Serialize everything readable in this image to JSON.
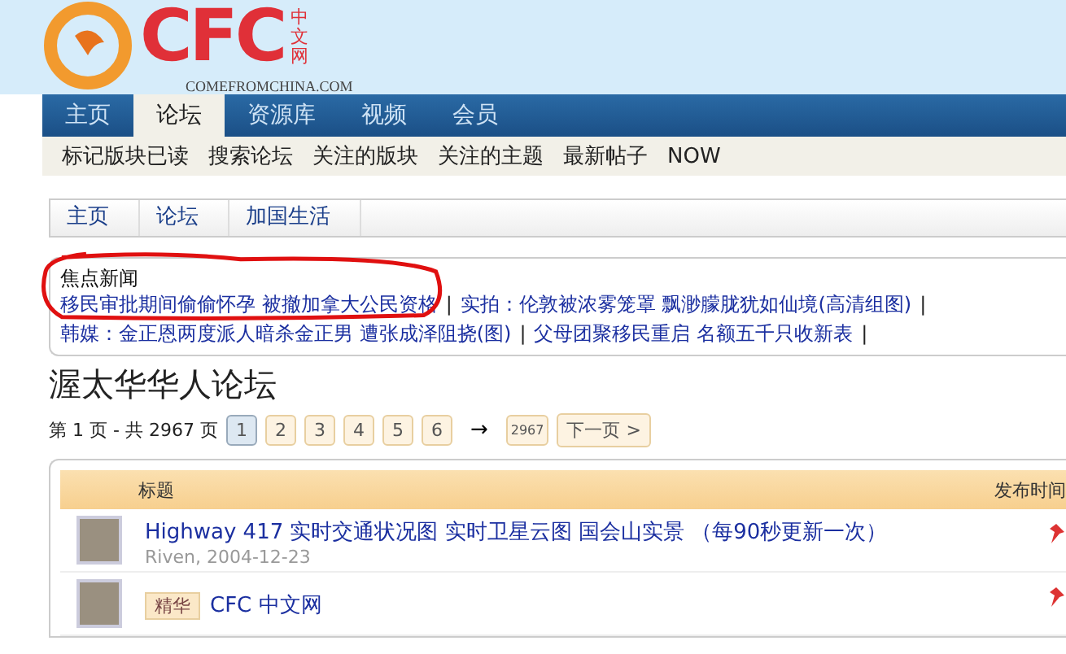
{
  "logo": {
    "letters": "CFC",
    "cn": "中文网",
    "domain": "COMEFROMCHINA.COM"
  },
  "nav": [
    {
      "label": "主页",
      "selected": false
    },
    {
      "label": "论坛",
      "selected": true
    },
    {
      "label": "资源库",
      "selected": false
    },
    {
      "label": "视频",
      "selected": false
    },
    {
      "label": "会员",
      "selected": false
    }
  ],
  "subnav": [
    "标记版块已读",
    "搜索论坛",
    "关注的版块",
    "关注的主题",
    "最新帖子",
    "NOW"
  ],
  "breadcrumbs": [
    "主页",
    "论坛",
    "加国生活"
  ],
  "news": {
    "title": "焦点新闻",
    "separator": "|",
    "lines": [
      [
        "移民审批期间偷偷怀孕 被撤加拿大公民资格",
        "实拍：伦敦被浓雾笼罩 飘渺朦胧犹如仙境(高清组图)"
      ],
      [
        "韩媒：金正恩两度派人暗杀金正男 遭张成泽阻挠(图)",
        "父母团聚移民重启 名额五千只收新表"
      ]
    ]
  },
  "forum_title": "渥太华华人论坛",
  "pagination": {
    "summary": "第 1 页 - 共 2967 页",
    "pages": [
      {
        "label": "1",
        "selected": true
      },
      {
        "label": "2",
        "selected": false
      },
      {
        "label": "3",
        "selected": false
      },
      {
        "label": "4",
        "selected": false
      },
      {
        "label": "5",
        "selected": false
      },
      {
        "label": "6",
        "selected": false
      }
    ],
    "arrow": "→",
    "last": "2967",
    "next": "下一页 >"
  },
  "table": {
    "columns": [
      "标题",
      "发布时间"
    ],
    "rows": [
      {
        "title": "Highway 417 实时交通状况图 实时卫星云图 国会山实景 （每90秒更新一次）",
        "author": "Riven,",
        "date": "2004-12-23",
        "pinned": true
      },
      {
        "badge": "精华",
        "title": "CFC 中文网",
        "pinned": true
      }
    ]
  }
}
